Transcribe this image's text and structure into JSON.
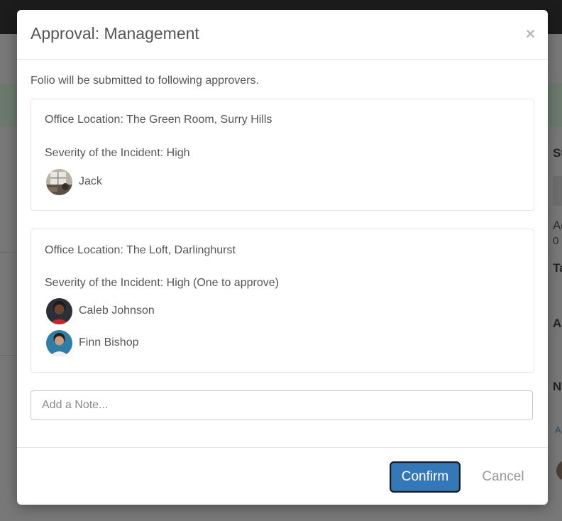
{
  "modal": {
    "title": "Approval: Management",
    "close_label": "×",
    "intro": "Folio will be submitted to following approvers.",
    "groups": [
      {
        "location": "Office Location: The Green Room, Surry Hills",
        "severity": "Severity of the Incident: High",
        "approvers": [
          {
            "name": "Jack"
          }
        ]
      },
      {
        "location": "Office Location: The Loft, Darlinghurst",
        "severity": "Severity of the Incident: High (One to approve)",
        "approvers": [
          {
            "name": "Caleb Johnson"
          },
          {
            "name": "Finn Bishop"
          }
        ]
      }
    ],
    "note": {
      "value": "",
      "placeholder": "Add a Note..."
    },
    "footer": {
      "confirm_label": "Confirm",
      "cancel_label": "Cancel"
    }
  },
  "background": {
    "fragments": [
      "St",
      "Ag",
      "0",
      "Ta",
      "A",
      "N",
      "A"
    ]
  },
  "colors": {
    "accent": "#3478b9",
    "overlay": "#787878",
    "text": "#555555"
  }
}
